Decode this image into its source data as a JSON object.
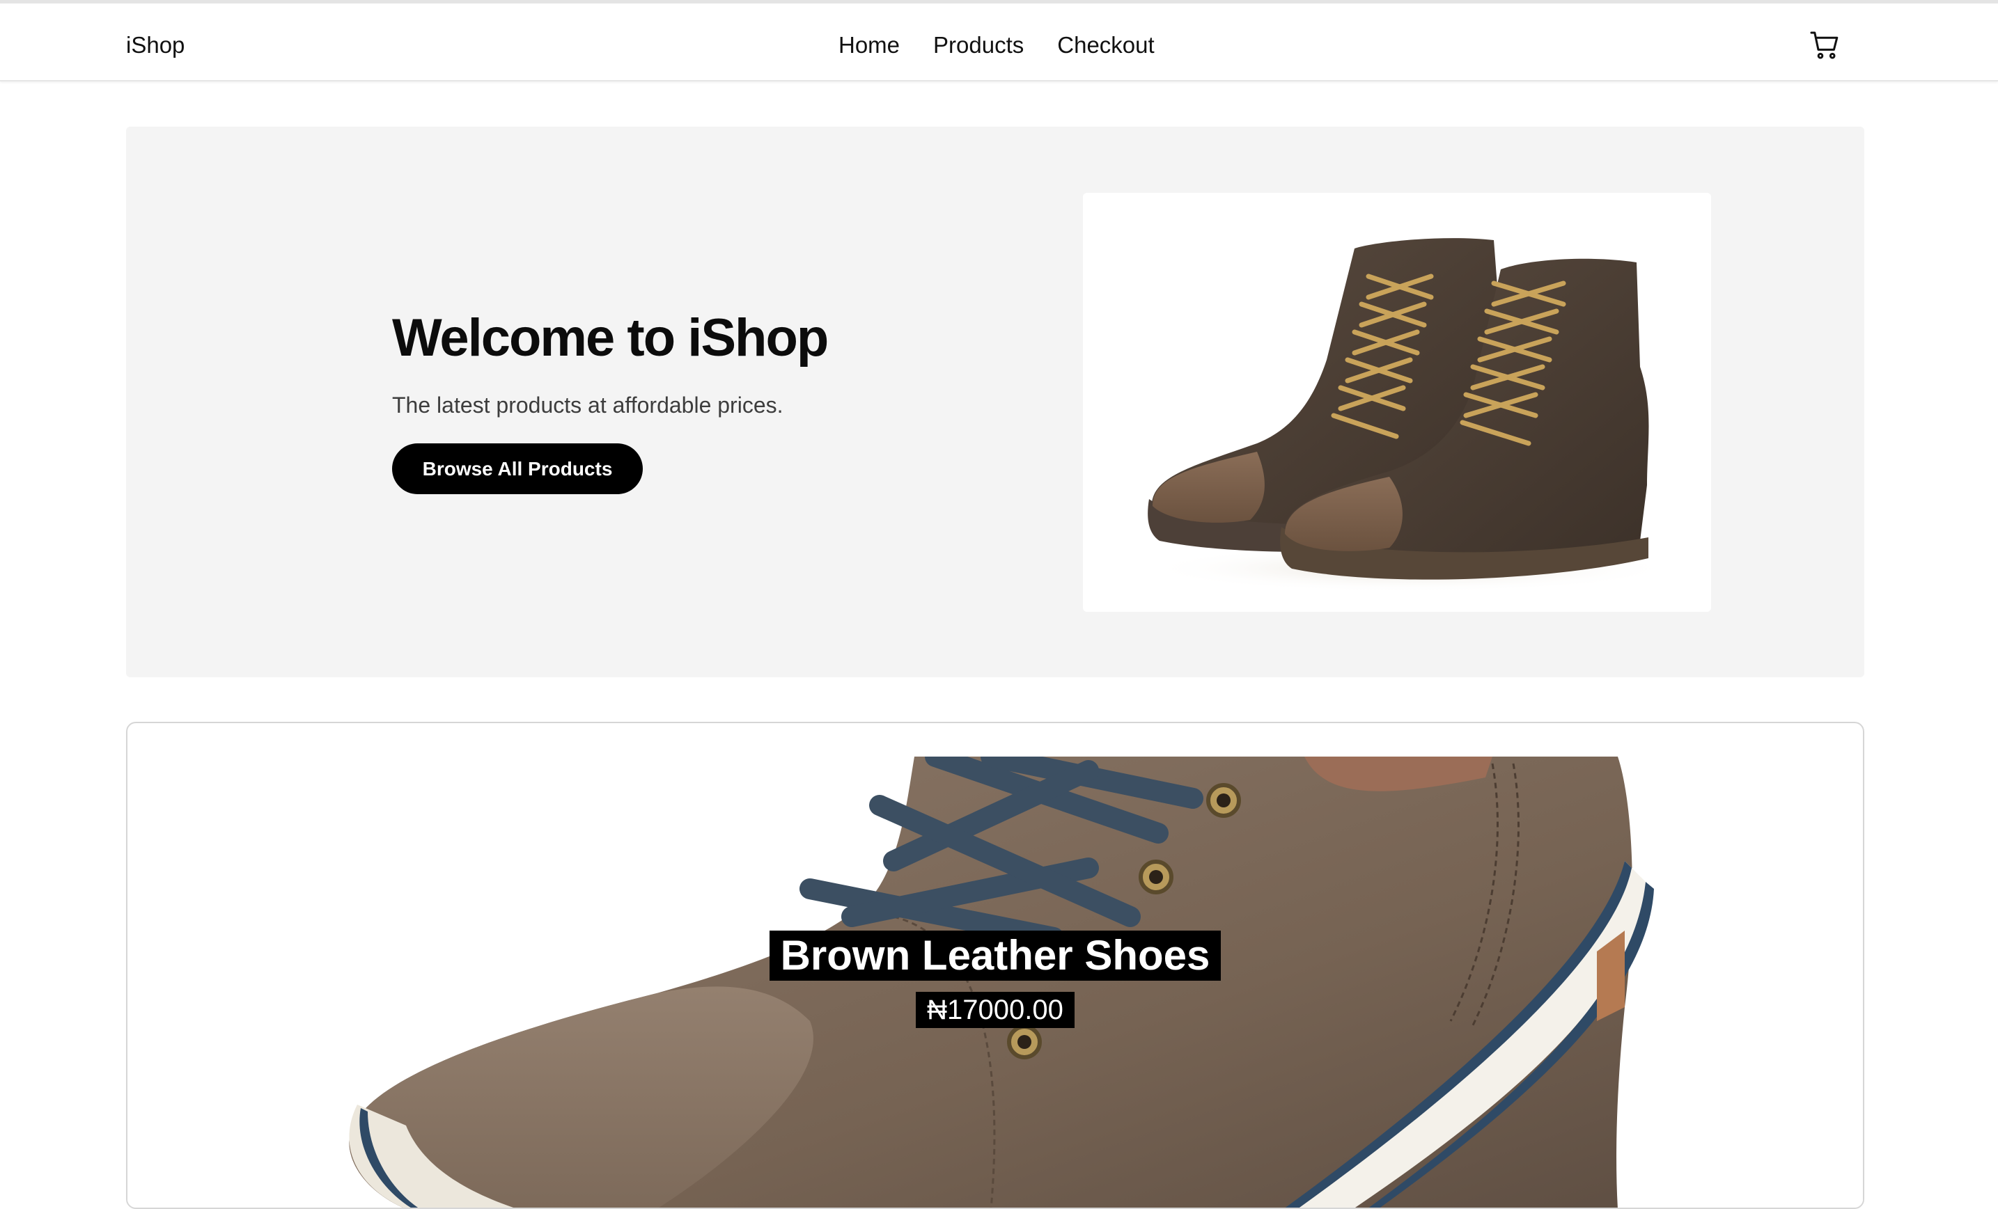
{
  "header": {
    "brand": "iShop",
    "nav": [
      "Home",
      "Products",
      "Checkout"
    ],
    "cart_icon": "shopping-cart-icon"
  },
  "hero": {
    "title": "Welcome to iShop",
    "subtitle": "The latest products at affordable prices.",
    "button_label": "Browse All Products",
    "image": "brown-suede-high-top-sneakers"
  },
  "featured_product": {
    "name": "Brown Leather Shoes",
    "price": "₦17000.00",
    "image": "brown-leather-shoe-closeup"
  },
  "colors": {
    "accent": "#000000",
    "hero_background": "#f4f4f4",
    "card_border": "#d6d6d6"
  }
}
